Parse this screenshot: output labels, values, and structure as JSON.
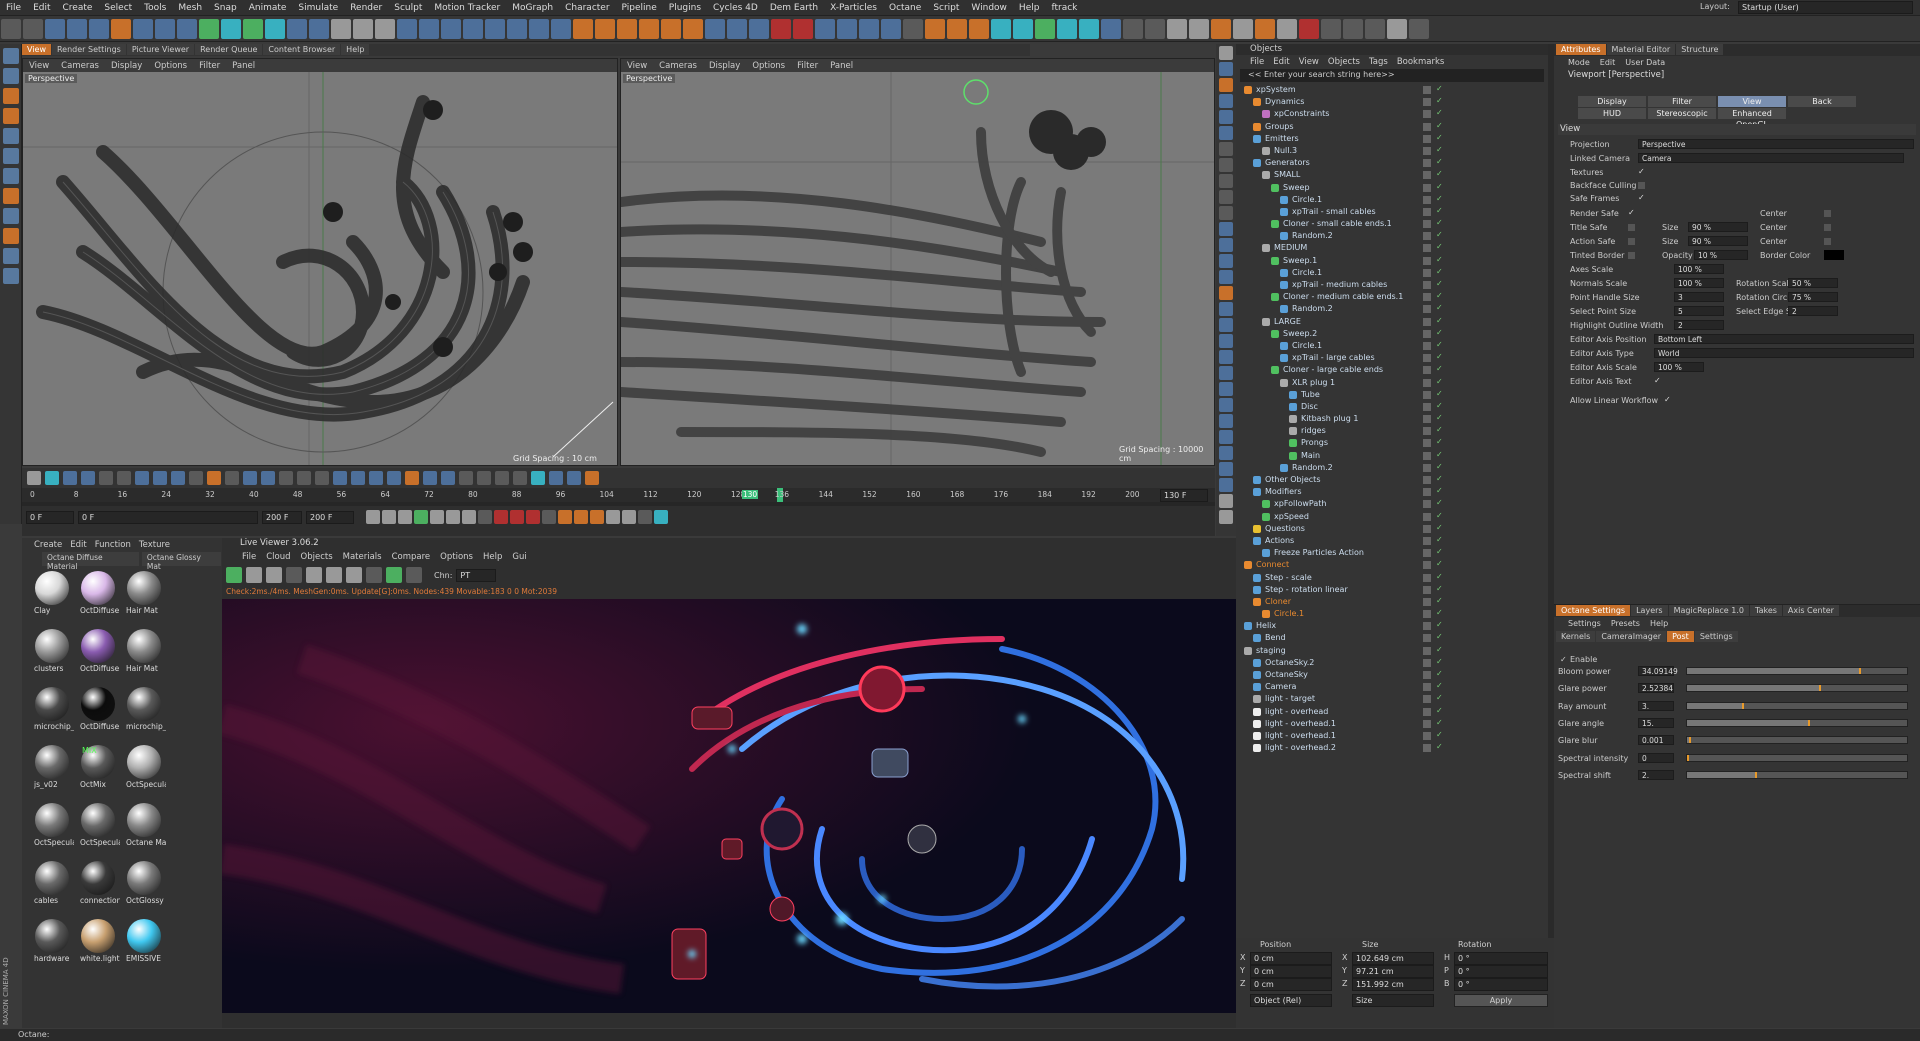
{
  "menu": [
    "File",
    "Edit",
    "Create",
    "Select",
    "Tools",
    "Mesh",
    "Snap",
    "Animate",
    "Simulate",
    "Render",
    "Sculpt",
    "Motion Tracker",
    "MoGraph",
    "Character",
    "Pipeline",
    "Plugins",
    "Cycles 4D",
    "Dem Earth",
    "X-Particles",
    "Octane",
    "Script",
    "Window",
    "Help",
    "ftrack"
  ],
  "layout": {
    "label": "Layout:",
    "value": "Startup (User)"
  },
  "left_view_tabs": [
    "View",
    "Render Settings",
    "Picture Viewer",
    "Render Queue",
    "Content Browser",
    "Help"
  ],
  "viewport1": {
    "menu": [
      "View",
      "Cameras",
      "Display",
      "Options",
      "Filter",
      "Panel"
    ],
    "label": "Perspective",
    "grid": "Grid Spacing : 10 cm"
  },
  "viewport2": {
    "menu": [
      "View",
      "Cameras",
      "Display",
      "Options",
      "Filter",
      "Panel"
    ],
    "label": "Perspective",
    "grid": "Grid Spacing : 10000 cm"
  },
  "timeline": {
    "ticks": [
      "0",
      "8",
      "16",
      "24",
      "32",
      "40",
      "48",
      "56",
      "64",
      "72",
      "80",
      "88",
      "96",
      "104",
      "112",
      "120",
      "128",
      "130",
      "136",
      "144",
      "152",
      "160",
      "168",
      "176",
      "184",
      "192",
      "200"
    ],
    "current_frame": "130",
    "end_frame": "130 F",
    "start": "0 F",
    "mid": "0 F",
    "max": "200 F",
    "max2": "200 F"
  },
  "material_panel": {
    "menu": [
      "Create",
      "Edit",
      "Function",
      "Texture"
    ],
    "tabs": [
      "Octane Diffuse Material",
      "Octane Glossy Mat"
    ],
    "materials": [
      {
        "name": "Clay",
        "color": "#d8d8d8"
      },
      {
        "name": "OctDiffuse",
        "color": "#d9b8e8"
      },
      {
        "name": "Hair Mat",
        "color": "#8a8a8a"
      },
      {
        "name": "clusters",
        "color": "#9a9a9a"
      },
      {
        "name": "OctDiffuse",
        "color": "#8a5cb0"
      },
      {
        "name": "Hair Mat",
        "color": "#8a8a8a"
      },
      {
        "name": "microchip_",
        "color": "#4a4a4a"
      },
      {
        "name": "OctDiffuse",
        "color": "#0c0c0c"
      },
      {
        "name": "microchip_",
        "color": "#5a5a5a"
      },
      {
        "name": "js_v02",
        "color": "#6a6a6a"
      },
      {
        "name": "OctMix",
        "color": "#5a5a5a"
      },
      {
        "name": "OctSpecula",
        "color": "#b0b0b0"
      },
      {
        "name": "OctSpecula",
        "color": "#7a7a7a"
      },
      {
        "name": "OctSpecula",
        "color": "#6a6a6a"
      },
      {
        "name": "Octane Ma",
        "color": "#888888"
      },
      {
        "name": "cables",
        "color": "#6a6a6a"
      },
      {
        "name": "connection",
        "color": "#3a3a3a"
      },
      {
        "name": "OctGlossy",
        "color": "#7a7a7a"
      },
      {
        "name": "hardware",
        "color": "#5a5a5a"
      },
      {
        "name": "white.light",
        "color": "#c8a070"
      },
      {
        "name": "EMISSIVE",
        "color": "#40c8f0"
      }
    ],
    "mix_label": "MIX"
  },
  "live_viewer": {
    "title": "Live Viewer 3.06.2",
    "menu": [
      "File",
      "Cloud",
      "Objects",
      "Materials",
      "Compare",
      "Options",
      "Help",
      "Gui"
    ],
    "channel_label": "Chn:",
    "channel_value": "PT",
    "status": "Check:2ms./4ms. MeshGen:0ms. Update[G]:0ms. Nodes:439 Movable:183  0 0 Mot:2039"
  },
  "objects_panel": {
    "title": "Objects",
    "menu": [
      "File",
      "Edit",
      "View",
      "Objects",
      "Tags",
      "Bookmarks"
    ],
    "search_placeholder": "<< Enter your search string here>>",
    "items": [
      {
        "name": "xpSystem",
        "depth": 0,
        "color": "#e88a30"
      },
      {
        "name": "Dynamics",
        "depth": 1,
        "color": "#e88a30"
      },
      {
        "name": "xpConstraints",
        "depth": 2,
        "color": "#c070c0"
      },
      {
        "name": "Groups",
        "depth": 1,
        "color": "#e88a30"
      },
      {
        "name": "Emitters",
        "depth": 1,
        "color": "#5aa0d8"
      },
      {
        "name": "Null.3",
        "depth": 2,
        "color": "#aaaaaa"
      },
      {
        "name": "Generators",
        "depth": 1,
        "color": "#5aa0d8"
      },
      {
        "name": "SMALL",
        "depth": 2,
        "color": "#aaaaaa"
      },
      {
        "name": "Sweep",
        "depth": 3,
        "color": "#50c060"
      },
      {
        "name": "Circle.1",
        "depth": 4,
        "color": "#5aa0d8"
      },
      {
        "name": "xpTrail - small cables",
        "depth": 4,
        "color": "#5aa0d8"
      },
      {
        "name": "Cloner - small cable ends.1",
        "depth": 3,
        "color": "#50c060"
      },
      {
        "name": "Random.2",
        "depth": 4,
        "color": "#5aa0d8"
      },
      {
        "name": "MEDIUM",
        "depth": 2,
        "color": "#aaaaaa"
      },
      {
        "name": "Sweep.1",
        "depth": 3,
        "color": "#50c060"
      },
      {
        "name": "Circle.1",
        "depth": 4,
        "color": "#5aa0d8"
      },
      {
        "name": "xpTrail - medium cables",
        "depth": 4,
        "color": "#5aa0d8"
      },
      {
        "name": "Cloner - medium cable ends.1",
        "depth": 3,
        "color": "#50c060"
      },
      {
        "name": "Random.2",
        "depth": 4,
        "color": "#5aa0d8"
      },
      {
        "name": "LARGE",
        "depth": 2,
        "color": "#aaaaaa"
      },
      {
        "name": "Sweep.2",
        "depth": 3,
        "color": "#50c060"
      },
      {
        "name": "Circle.1",
        "depth": 4,
        "color": "#5aa0d8"
      },
      {
        "name": "xpTrail - large cables",
        "depth": 4,
        "color": "#5aa0d8"
      },
      {
        "name": "Cloner - large cable ends",
        "depth": 3,
        "color": "#50c060"
      },
      {
        "name": "XLR plug 1",
        "depth": 4,
        "color": "#aaaaaa"
      },
      {
        "name": "Tube",
        "depth": 5,
        "color": "#5aa0d8"
      },
      {
        "name": "Disc",
        "depth": 5,
        "color": "#5aa0d8"
      },
      {
        "name": "Kitbash plug 1",
        "depth": 5,
        "color": "#aaaaaa"
      },
      {
        "name": "ridges",
        "depth": 5,
        "color": "#aaaaaa"
      },
      {
        "name": "Prongs",
        "depth": 5,
        "color": "#50c060"
      },
      {
        "name": "Main",
        "depth": 5,
        "color": "#50c060"
      },
      {
        "name": "Random.2",
        "depth": 4,
        "color": "#5aa0d8"
      },
      {
        "name": "Other Objects",
        "depth": 1,
        "color": "#5aa0d8"
      },
      {
        "name": "Modifiers",
        "depth": 1,
        "color": "#5aa0d8"
      },
      {
        "name": "xpFollowPath",
        "depth": 2,
        "color": "#50c060"
      },
      {
        "name": "xpSpeed",
        "depth": 2,
        "color": "#50c060"
      },
      {
        "name": "Questions",
        "depth": 1,
        "color": "#e8c030"
      },
      {
        "name": "Actions",
        "depth": 1,
        "color": "#5aa0d8"
      },
      {
        "name": "Freeze Particles Action",
        "depth": 2,
        "color": "#5aa0d8"
      },
      {
        "name": "Connect",
        "depth": 0,
        "color": "#e88a30"
      },
      {
        "name": "Step - scale",
        "depth": 1,
        "color": "#5aa0d8"
      },
      {
        "name": "Step - rotation linear",
        "depth": 1,
        "color": "#5aa0d8"
      },
      {
        "name": "Cloner",
        "depth": 1,
        "color": "#e88a30"
      },
      {
        "name": "Circle.1",
        "depth": 2,
        "color": "#e88a30"
      },
      {
        "name": "Helix",
        "depth": 0,
        "color": "#5aa0d8"
      },
      {
        "name": "Bend",
        "depth": 1,
        "color": "#5aa0d8"
      },
      {
        "name": "staging",
        "depth": 0,
        "color": "#aaaaaa"
      },
      {
        "name": "OctaneSky.2",
        "depth": 1,
        "color": "#5aa0d8"
      },
      {
        "name": "OctaneSky",
        "depth": 1,
        "color": "#5aa0d8"
      },
      {
        "name": "Camera",
        "depth": 1,
        "color": "#5aa0d8"
      },
      {
        "name": "light - target",
        "depth": 1,
        "color": "#aaaaaa"
      },
      {
        "name": "light - overhead",
        "depth": 1,
        "color": "#eeeeee"
      },
      {
        "name": "light - overhead.1",
        "depth": 1,
        "color": "#eeeeee"
      },
      {
        "name": "light - overhead.1",
        "depth": 1,
        "color": "#eeeeee"
      },
      {
        "name": "light - overhead.2",
        "depth": 1,
        "color": "#eeeeee"
      }
    ]
  },
  "coords": {
    "headers": [
      "Position",
      "Size",
      "Rotation"
    ],
    "rows": [
      {
        "axis": "X",
        "pos": "0 cm",
        "size_axis": "X",
        "size": "102.649 cm",
        "rot_axis": "H",
        "rot": "0 °"
      },
      {
        "axis": "Y",
        "pos": "0 cm",
        "size_axis": "Y",
        "size": "97.21 cm",
        "rot_axis": "P",
        "rot": "0 °"
      },
      {
        "axis": "Z",
        "pos": "0 cm",
        "size_axis": "Z",
        "size": "151.992 cm",
        "rot_axis": "B",
        "rot": "0 °"
      }
    ],
    "mode": "Object (Rel)",
    "size_mode": "Size",
    "apply": "Apply"
  },
  "attributes": {
    "tabs": [
      "Attributes",
      "Material Editor",
      "Structure"
    ],
    "menu": [
      "Mode",
      "Edit",
      "User Data"
    ],
    "title": "Viewport [Perspective]",
    "subtabs": [
      "Display",
      "Filter",
      "View",
      "Back",
      "HUD",
      "Stereoscopic",
      "Enhanced OpenGL"
    ],
    "section": "View",
    "projection_label": "Projection",
    "projection": "Perspective",
    "linked_camera_label": "Linked Camera",
    "linked_camera": "Camera",
    "textures": "Textures",
    "backface": "Backface Culling",
    "safe_frames": "Safe Frames",
    "render_safe": "Render Safe",
    "center": "Center",
    "title_safe": "Title Safe",
    "action_safe": "Action Safe",
    "size": "Size",
    "size_val": "90 %",
    "size_val2": "90 %",
    "tinted_border": "Tinted Border",
    "opacity": "Opacity",
    "opacity_val": "10 %",
    "border_color": "Border Color",
    "axes_scale": "Axes Scale",
    "axes_scale_val": "100 %",
    "normals_scale": "Normals Scale",
    "normals_scale_val": "100 %",
    "rotation_scale": "Rotation Scale",
    "rotation_scale_val": "50 %",
    "point_handle": "Point Handle Size",
    "point_handle_val": "3",
    "rotation_circle": "Rotation Circle",
    "rotation_circle_val": "75 %",
    "select_point": "Select Point Size",
    "select_point_val": "5",
    "select_edge": "Select Edge Size",
    "select_edge_val": "2",
    "highlight": "Highlight Outline Width",
    "highlight_val": "2",
    "axis_pos": "Editor Axis Position",
    "axis_pos_val": "Bottom Left",
    "axis_type": "Editor Axis Type",
    "axis_type_val": "World",
    "axis_scale": "Editor Axis Scale",
    "axis_scale_val": "100 %",
    "axis_text": "Editor Axis Text",
    "linear": "Allow Linear Workflow"
  },
  "octane_settings": {
    "tabs": [
      "Octane Settings",
      "Layers",
      "MagicReplace 1.0",
      "Takes",
      "Axis Center"
    ],
    "menu": [
      "Settings",
      "Presets",
      "Help"
    ],
    "subtabs": [
      "Kernels",
      "CameraImager",
      "Post",
      "Settings"
    ],
    "enable": "Enable",
    "params": [
      {
        "label": "Bloom power",
        "value": "34.09149",
        "level": 0.78
      },
      {
        "label": "Glare power",
        "value": "2.52384",
        "level": 0.6
      },
      {
        "label": "Ray amount",
        "value": "3.",
        "level": 0.25
      },
      {
        "label": "Glare angle",
        "value": "15.",
        "level": 0.55
      },
      {
        "label": "Glare blur",
        "value": "0.001",
        "level": 0.01
      },
      {
        "label": "Spectral intensity",
        "value": "0",
        "level": 0.0
      },
      {
        "label": "Spectral shift",
        "value": "2.",
        "level": 0.31
      }
    ]
  },
  "status_bar": "Octane:",
  "maxon_logo": "MAXON CINEMA 4D"
}
